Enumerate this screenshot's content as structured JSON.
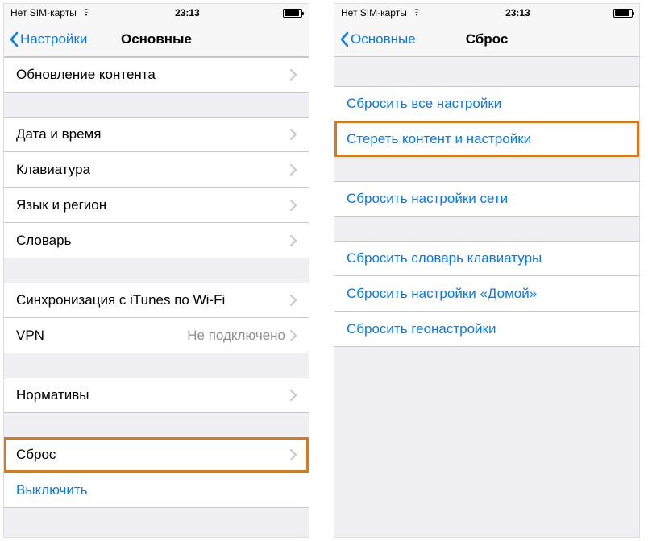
{
  "statusbar": {
    "carrier": "Нет SIM-карты",
    "time": "23:13"
  },
  "left": {
    "back": "Настройки",
    "title": "Основные",
    "groups": [
      [
        {
          "label": "Обновление контента",
          "chevron": true
        }
      ],
      [
        {
          "label": "Дата и время",
          "chevron": true
        },
        {
          "label": "Клавиатура",
          "chevron": true
        },
        {
          "label": "Язык и регион",
          "chevron": true
        },
        {
          "label": "Словарь",
          "chevron": true
        }
      ],
      [
        {
          "label": "Синхронизация с iTunes по Wi-Fi",
          "chevron": true
        },
        {
          "label": "VPN",
          "value": "Не подключено",
          "chevron": true
        }
      ],
      [
        {
          "label": "Нормативы",
          "chevron": true
        }
      ],
      [
        {
          "label": "Сброс",
          "chevron": true,
          "highlighted": true
        },
        {
          "label": "Выключить",
          "link": true
        }
      ]
    ]
  },
  "right": {
    "back": "Основные",
    "title": "Сброс",
    "groups": [
      [
        {
          "label": "Сбросить все настройки",
          "link": true
        },
        {
          "label": "Стереть контент и настройки",
          "link": true,
          "highlighted": true
        }
      ],
      [
        {
          "label": "Сбросить настройки сети",
          "link": true
        }
      ],
      [
        {
          "label": "Сбросить словарь клавиатуры",
          "link": true
        },
        {
          "label": "Сбросить настройки «Домой»",
          "link": true
        },
        {
          "label": "Сбросить геонастройки",
          "link": true
        }
      ]
    ],
    "firstGroupMargin": 36
  }
}
